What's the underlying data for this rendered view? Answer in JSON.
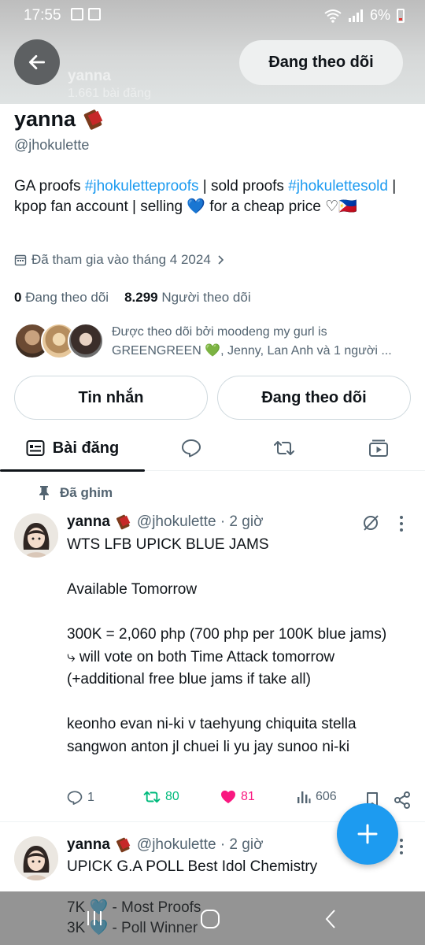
{
  "status_bar": {
    "time": "17:55",
    "battery": "6%"
  },
  "header": {
    "ghost_name": "yanna",
    "ghost_count": "1.661 bài đăng",
    "follow_label": "Đang theo dõi"
  },
  "profile": {
    "name": "yanna",
    "handle": "@jhokulette",
    "bio_1": "GA proofs ",
    "bio_tag1": "#jhokuletteproofs",
    "bio_2": " | sold proofs ",
    "bio_tag2": "#jhokulettesold",
    "bio_3": " | kpop fan account | selling 💙 for a cheap price ♡🇵🇭",
    "joined": "Đã tham gia vào tháng 4 2024",
    "following_count": "0",
    "following_label": "Đang theo dõi",
    "followers_count": "8.299",
    "followers_label": "Người theo dõi",
    "followed_by": "Được theo dõi bởi moodeng my gurl is GREENGREEN 💚, Jenny, Lan Anh và 1 người ..."
  },
  "buttons": {
    "message": "Tin nhắn",
    "following": "Đang theo dõi"
  },
  "tabs": {
    "posts": "Bài đăng"
  },
  "tweets": [
    {
      "pinned_label": "Đã ghim",
      "name": "yanna",
      "meta": "@jhokulette · 2 giờ",
      "text": "WTS LFB UPICK BLUE JAMS\n\nAvailable Tomorrow\n\n300K = 2,060 php (700 php per 100K blue jams)\n⤷ will vote on both Time Attack tomorrow (+additional free blue jams if take all)\n\nkeonho evan ni-ki v taehyung chiquita stella sangwon anton jl chuei li yu jay sunoo ni-ki",
      "replies": "1",
      "retweets": "80",
      "likes": "81",
      "views": "606"
    },
    {
      "name": "yanna",
      "meta": "@jhokulette · 2 giờ",
      "text": "UPICK G.A POLL Best Idol Chemistry\n\n7K 🩵 - Most Proofs\n3K 🩵 - Poll Winner"
    }
  ],
  "colors": {
    "accent": "#1d9bf0",
    "retweet": "#00ba7c",
    "like": "#f91880"
  }
}
